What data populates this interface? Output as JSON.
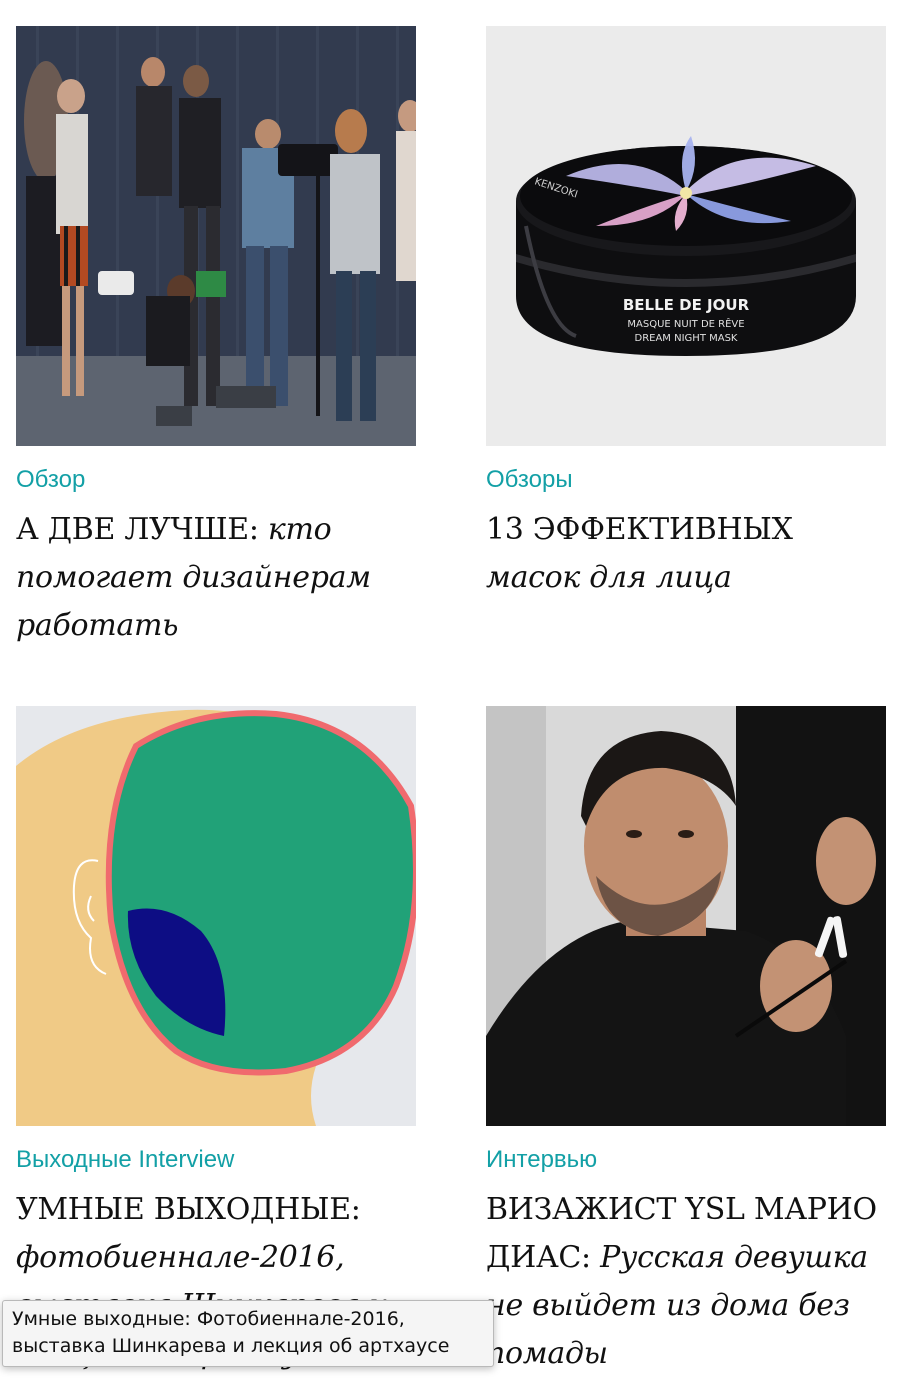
{
  "articles": [
    {
      "category": "Обзор",
      "title_caps": "А ДВЕ ЛУЧШЕ:",
      "title_italic": " кто помогает дизайнерам работать",
      "image": "fashion-backstage-photo"
    },
    {
      "category": "Обзоры",
      "title_caps": "13 ЭФФЕКТИВНЫХ",
      "title_italic": " масок для лица",
      "image": "kenzo-ki-mask-jar-photo",
      "image_text": {
        "brand": "KENZOKI",
        "line1": "BELLE DE JOUR",
        "line2": "MASQUE NUIT DE RÊVE",
        "line3": "DREAM NIGHT MASK"
      }
    },
    {
      "category": "Выходные Interview",
      "title_caps": "УМНЫЕ ВЫХОДНЫЕ:",
      "title_italic": " фотобиеннале-2016, выставка Шинкарева и лекция об артхаусе",
      "image": "head-profile-illustration"
    },
    {
      "category": "Интервью",
      "title_caps": "ВИЗАЖИСТ YSL МАРИО ДИАС:",
      "title_italic": " Русская девушка не выйдет из дома без помады",
      "image": "makeup-artist-portrait-photo"
    }
  ],
  "tooltip": {
    "line1": "Умные выходные: Фотобиеннале-2016,",
    "line2": "выставка Шинкарева и лекция об артхаусе"
  },
  "colors": {
    "category": "#13a0a6",
    "headline": "#111111",
    "tooltip_bg": "#f5f5f5"
  }
}
